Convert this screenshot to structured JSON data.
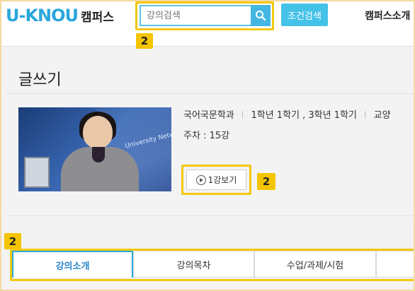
{
  "header": {
    "logo_mark": "U-KNOU",
    "logo_sub": "캠퍼스",
    "search": {
      "placeholder": "강의검색",
      "value": ""
    },
    "condition_search_label": "조건검색",
    "nav_campus_intro": "캠퍼스소개"
  },
  "annotations": {
    "search_badge": "2",
    "play_badge": "2",
    "tabs_badge": "2"
  },
  "course": {
    "title": "글쓰기",
    "department": "국어국문학과",
    "grade_term": "1학년 1학기 , 3학년 1학기",
    "category": "교양",
    "weeks": "주차 : 15강",
    "play_label": "1강보기",
    "thumbnail_text": "University Netw"
  },
  "tabs": [
    {
      "label": "강의소개",
      "active": true
    },
    {
      "label": "강의목차",
      "active": false
    },
    {
      "label": "수업/과제/시험",
      "active": false
    },
    {
      "label": "",
      "active": false
    }
  ],
  "colors": {
    "accent": "#2aa7dc",
    "highlight": "#f2c811",
    "badge": "#f5c400"
  },
  "icons": {
    "search": "search-icon",
    "play": "play-circle-icon"
  }
}
